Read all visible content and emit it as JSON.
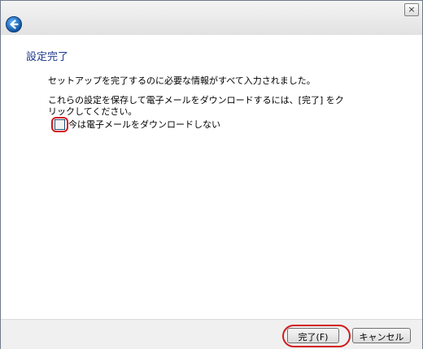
{
  "window": {
    "close_label": "×",
    "back_icon": "back-arrow-icon"
  },
  "page": {
    "heading": "設定完了",
    "message": "セットアップを完了するのに必要な情報がすべて入力されました。",
    "instruction": "これらの設定を保存して電子メールをダウンロードするには、[完了] をクリックしてください。"
  },
  "checkbox": {
    "label": "今は電子メールをダウンロードしない",
    "checked": false
  },
  "footer": {
    "finish_label": "完了(F)",
    "cancel_label": "キャンセル"
  },
  "colors": {
    "heading": "#1e3a8a",
    "annotation": "#d21a1a"
  }
}
